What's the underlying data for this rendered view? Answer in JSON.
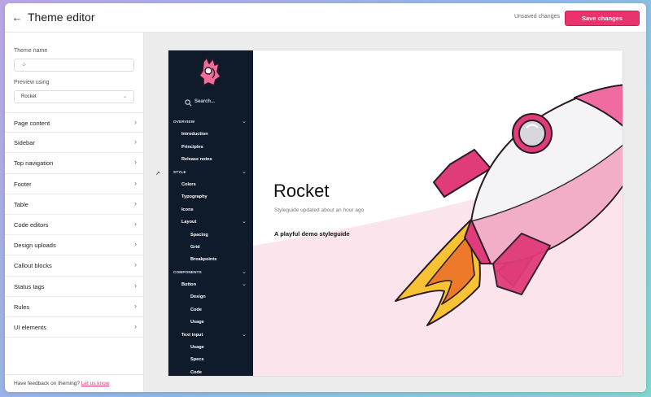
{
  "header": {
    "title": "Theme editor",
    "unsaved_text": "Unsaved changes",
    "save_label": "Save changes"
  },
  "left_panel": {
    "theme_name_label": "Theme name",
    "theme_name_value": "·ᴊ·",
    "preview_label": "Preview using",
    "preview_value": "Rocket",
    "sections": [
      "Page content",
      "Sidebar",
      "Top navigation",
      "Footer",
      "Table",
      "Code editors",
      "Design uploads",
      "Callout blocks",
      "Status tags",
      "Rules",
      "UI elements"
    ],
    "feedback_text": "Have feedback on theming?",
    "feedback_link": "Let us know"
  },
  "preview": {
    "search_label": "Search...",
    "nav": [
      {
        "label": "OVERVIEW",
        "level": 0,
        "header": true,
        "chevron": true
      },
      {
        "label": "Introduction",
        "level": 1
      },
      {
        "label": "Principles",
        "level": 1
      },
      {
        "label": "Release notes",
        "level": 1
      },
      {
        "label": "STYLE",
        "level": 0,
        "header": true,
        "chevron": true
      },
      {
        "label": "Colors",
        "level": 1
      },
      {
        "label": "Typography",
        "level": 1
      },
      {
        "label": "Icons",
        "level": 1
      },
      {
        "label": "Layout",
        "level": 1,
        "chevron": true
      },
      {
        "label": "Spacing",
        "level": 2
      },
      {
        "label": "Grid",
        "level": 2
      },
      {
        "label": "Breakpoints",
        "level": 2
      },
      {
        "label": "COMPONENTS",
        "level": 0,
        "header": true,
        "chevron": true
      },
      {
        "label": "Button",
        "level": 1,
        "chevron": true
      },
      {
        "label": "Design",
        "level": 2
      },
      {
        "label": "Code",
        "level": 2
      },
      {
        "label": "Usage",
        "level": 2
      },
      {
        "label": "Text input",
        "level": 1,
        "chevron": true
      },
      {
        "label": "Usage",
        "level": 2
      },
      {
        "label": "Specs",
        "level": 2
      },
      {
        "label": "Code",
        "level": 2
      }
    ],
    "hero_title": "Rocket",
    "hero_subtitle": "Styleguide updated about an hour ago",
    "hero_tagline": "A playful demo styleguide"
  },
  "colors": {
    "accent": "#e8336c",
    "sidebar_bg": "#0f1a2b",
    "hero_wave": "#fce4ec"
  },
  "icons": {
    "back": "arrow-left-icon",
    "chevron": "chevron-right-icon",
    "search": "search-icon",
    "caret": "chevron-down-icon"
  }
}
